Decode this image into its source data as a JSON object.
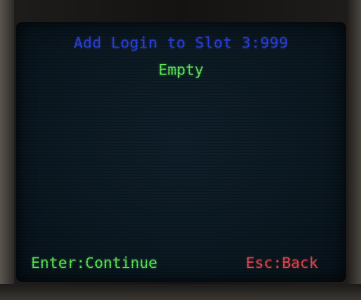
{
  "screen": {
    "title": "Add Login to Slot 3:999",
    "status": "Empty"
  },
  "footer": {
    "enter_label": "Enter:Continue",
    "esc_label": "Esc:Back"
  },
  "colors": {
    "title": "#2c3fd6",
    "status": "#5fe05a",
    "continue": "#5fe05a",
    "back": "#e0484f",
    "screen_bg": "#0b1821"
  }
}
